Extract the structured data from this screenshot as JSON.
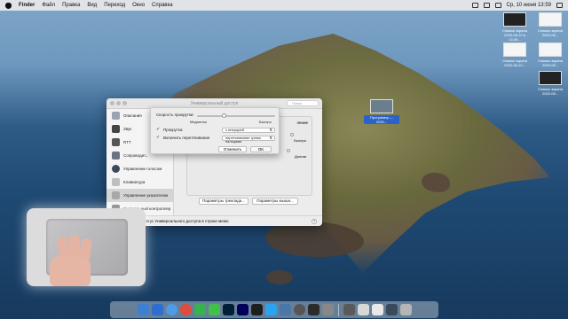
{
  "menubar": {
    "app": "Finder",
    "items": [
      "Файл",
      "Правка",
      "Вид",
      "Переход",
      "Окно",
      "Справка"
    ],
    "clock": "Ср, 10 июня  13:59"
  },
  "desktop": {
    "icons": [
      {
        "label": "Снимок экрана 2020-06-10 в 13.55..."
      },
      {
        "label": "Снимок экрана 2020-06..."
      },
      {
        "label": "Снимок экрана 2020-06-10..."
      },
      {
        "label": "Снимок экрана 2020-06..."
      },
      {
        "label": "Снимок экрана 2020-06..."
      }
    ],
    "selected_icon_label": "Программу — 2020..."
  },
  "window": {
    "title": "Универсальный доступ",
    "search_placeholder": "Поиск",
    "sidebar": [
      {
        "label": "Описания"
      },
      {
        "label": "Звук"
      },
      {
        "label": "RTT"
      },
      {
        "label": "Сопроводит..."
      },
      {
        "label": "Управление голосом"
      },
      {
        "label": "Клавиатура"
      },
      {
        "label": "Управление указателем"
      },
      {
        "label": "Виртуальный контроллер"
      }
    ],
    "right_fragments": {
      "a": "ление",
      "b": "Быстро",
      "c": "Долгая"
    },
    "buttons": {
      "trackpad_options": "Параметры трекпада...",
      "mouse_options": "Параметры мыши..."
    },
    "bottom_check_label": "Показывать статус Универсального доступа в строке меню",
    "help": "?"
  },
  "sheet": {
    "scroll_speed_label": "Скорость прокрутки:",
    "slow_label": "Медленно",
    "fast_label": "Быстро",
    "scroll_speed_value": 0.35,
    "scroll_check_label": "Прокрутка",
    "scroll_popup_value": "с инерцией",
    "drag_check_label": "Включить перетягивание",
    "drag_popup_value": "перетягивание тремя пальцами",
    "cancel_label": "Отменить",
    "ok_label": "OK"
  }
}
